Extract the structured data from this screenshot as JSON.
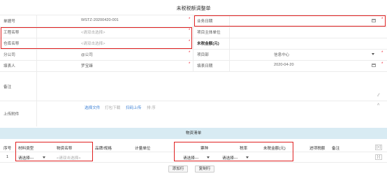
{
  "form": {
    "title": "未税税额调整单",
    "doc_no_label": "单据号",
    "doc_no_value": "WSTZ-20200420-001",
    "business_date_label": "业务日期",
    "project_label": "工程名称",
    "project_placeholder": "<请双击选择>",
    "project_entity_label": "项目主体单位",
    "warehouse_label": "仓库名称",
    "warehouse_placeholder": "<请双击选择>",
    "untaxed_total_label": "未税金额(元)",
    "branch_label": "分公司",
    "branch_value": "@公司",
    "dept_label": "项目部",
    "dept_value": "信息中心",
    "filler_label": "填表人",
    "filler_value": "罗宝臻",
    "fill_date_label": "填表日期",
    "fill_date_value": "2020-04-20",
    "remark_label": "备注",
    "attachment_label": "上传附件",
    "attach_actions": {
      "select_file": "选择文件",
      "package_download": "打包下载",
      "scan_upload": "扫码上传",
      "sort": "排 序"
    },
    "collapse_glyph": "^"
  },
  "materials": {
    "section_title": "物资清单",
    "headers": {
      "seq": "序号",
      "material_type": "材料类型",
      "material_name": "物资名称",
      "brand_spec": "品牌/规格",
      "unit": "计量单位",
      "tax_type": "票种",
      "tax_rate": "税率",
      "untaxed_amount": "未税金额(元)",
      "invoice_tax": "进项税额",
      "remark": "备注"
    },
    "add_col_glyph": "[+]",
    "row": {
      "seq": "1",
      "material_type": "请选择---",
      "material_name": "<请双击选择>",
      "tax_type": "请选择---",
      "tax_rate": "请选择---",
      "row_action_glyph": "[-]"
    },
    "add_row_button": "添加行",
    "copy_row_button": "复制行"
  }
}
